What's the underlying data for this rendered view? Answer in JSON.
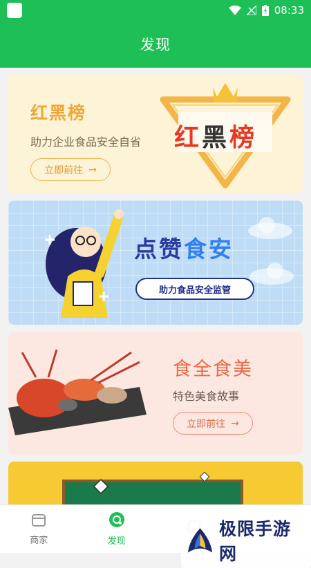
{
  "status_bar": {
    "time": "08:33"
  },
  "nav": {
    "title": "发现"
  },
  "cards": {
    "redblack": {
      "title": "红黑榜",
      "subtitle": "助力企业食品安全自省",
      "button": "立即前往",
      "art_text_red": "红",
      "art_text_dark": "黑",
      "art_text_end": "榜"
    },
    "like": {
      "title_dark": "点赞",
      "title_blue": "食安",
      "banner": "助力食品安全监管"
    },
    "food": {
      "title": "食全食美",
      "subtitle": "特色美食故事",
      "button": "立即前往"
    }
  },
  "tabs": [
    {
      "label": "商家",
      "icon": "shop-icon"
    },
    {
      "label": "发现",
      "icon": "discover-icon",
      "active": true
    },
    {
      "label": "",
      "icon": "tab-icon-3"
    },
    {
      "label": "",
      "icon": "tab-icon-4"
    }
  ],
  "watermark": {
    "text": "极限手游网"
  },
  "colors": {
    "primary": "#1fbf57",
    "orange": "#f0a73a",
    "coral": "#e86a48",
    "navy": "#2b3aa0"
  }
}
